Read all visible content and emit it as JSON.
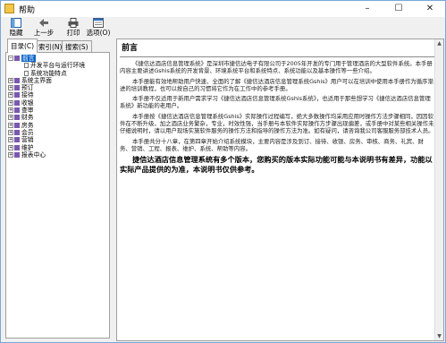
{
  "window": {
    "title": "帮助"
  },
  "toolbar": {
    "buttons": [
      {
        "label": "隐藏",
        "icon": "hide-icon"
      },
      {
        "label": "上一步",
        "icon": "back-arrow-icon"
      },
      {
        "label": "打印",
        "icon": "print-icon"
      },
      {
        "label": "选项(O)",
        "icon": "options-icon"
      }
    ]
  },
  "tabs": [
    {
      "label": "目录(C)",
      "active": true
    },
    {
      "label": "索引(N)",
      "active": false
    },
    {
      "label": "搜索(S)",
      "active": false
    }
  ],
  "tree": [
    {
      "label": "前言",
      "level": 1,
      "type": "book",
      "expanded": true,
      "selected": true
    },
    {
      "label": "开发平台与运行环境",
      "level": 2,
      "type": "page"
    },
    {
      "label": "系统功能特点",
      "level": 2,
      "type": "page"
    },
    {
      "label": "系统主界面",
      "level": 1,
      "type": "book"
    },
    {
      "label": "预订",
      "level": 1,
      "type": "book"
    },
    {
      "label": "接待",
      "level": 1,
      "type": "book"
    },
    {
      "label": "收银",
      "level": 1,
      "type": "book"
    },
    {
      "label": "查审",
      "level": 1,
      "type": "book"
    },
    {
      "label": "财务",
      "level": 1,
      "type": "book"
    },
    {
      "label": "房务",
      "level": 1,
      "type": "book"
    },
    {
      "label": "会员",
      "level": 1,
      "type": "book"
    },
    {
      "label": "营销",
      "level": 1,
      "type": "book"
    },
    {
      "label": "维护",
      "level": 1,
      "type": "book"
    },
    {
      "label": "报表中心",
      "level": 1,
      "type": "book"
    }
  ],
  "document": {
    "heading": "前言",
    "paragraphs": [
      "《捷信达酒店信息管理系统》是深圳市捷信达电子有限公司于2005年开发的专门用于管理酒店的大型软件系统。本手册内容主要讲述Gshis系统的开发背景、环境系统平台和系统特点、系统功能以及基本操作等一些介绍。",
      "本手册能有效地帮助用户快速、全面的了解《捷信达酒店信息管理系统Gshis》用户可以在培训中使用本手册作为循序渐进的培训教程，也可以按自己的习惯将它作为在工作中的参考手册。",
      "本手册不仅适用于新用户需求学习《捷信达酒店信息管理系统Gshis系统》，也适用于那些想学习《捷信达酒店信息管理系统》新功能的老用户。",
      "本手册按《捷信达酒店信息管理系统Gshis》实际操作过程编写，绝大多数操作均采用应用时操作方法步骤相同，因因软件在不断升级，加之酒店业务繁杂，专业，时效性强，当手册与本软件实际操作方步骤出现偏差，或手册中对某些相关操作未仔细说明时，请以用户现场实施软件服务的操作方法和指导的操作方法为准。如有疑问，请咨询我公司客服服务部技术人员。",
      "本手册共分十八章，在第四章开始介绍系统模块，主要内容是涉及到订、接待、收银、房务、审核、商务、礼宾、财务、营销、工程、报表、维护、系统、帮助等内容。"
    ],
    "notice": "捷信达酒店信息管理系统有多个版本，您购买的版本实际功能可能与本说明书有差异，功能以实际产品提供的为准，本说明书仅供参考。"
  }
}
